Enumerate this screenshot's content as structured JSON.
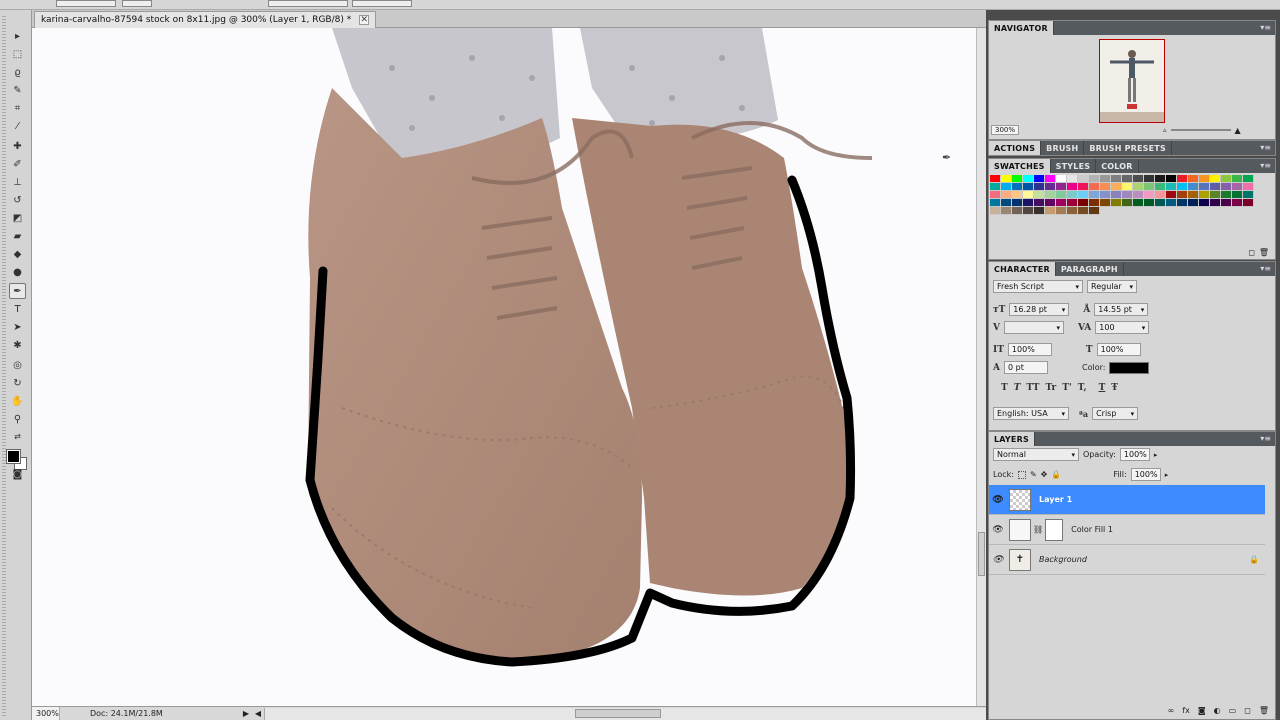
{
  "document": {
    "tab_title": "karina-carvalho-87594 stock on 8x11.jpg @ 300% (Layer 1, RGB/8) *",
    "close_glyph": "✕"
  },
  "status_bar": {
    "zoom": "300%",
    "doc_info": "Doc: 24.1M/21.8M",
    "arrow_right": "▶",
    "arrow_left": "◀"
  },
  "navigator": {
    "title": "NAVIGATOR",
    "zoom": "300%"
  },
  "actions_group": {
    "tabs": [
      "ACTIONS",
      "BRUSH",
      "BRUSH PRESETS"
    ]
  },
  "swatches_group": {
    "tabs": [
      "SWATCHES",
      "STYLES",
      "COLOR"
    ],
    "colors": [
      "#ff0000",
      "#ffff00",
      "#00ff00",
      "#00ffff",
      "#0000ff",
      "#ff00ff",
      "#ffffff",
      "#e6e6e6",
      "#cccccc",
      "#b3b3b3",
      "#999999",
      "#808080",
      "#666666",
      "#4d4d4d",
      "#333333",
      "#1a1a1a",
      "#000000",
      "#ed1c24",
      "#f26522",
      "#f7941d",
      "#fff200",
      "#8dc63f",
      "#39b54a",
      "#00a651",
      "#00a99d",
      "#00aeef",
      "#0072bc",
      "#0054a6",
      "#2e3192",
      "#662d91",
      "#92278f",
      "#ec008c",
      "#ed145b",
      "#f26c4f",
      "#f68e56",
      "#fbaf5d",
      "#fff568",
      "#acd373",
      "#7cc576",
      "#3cb878",
      "#1abbb4",
      "#00bff3",
      "#448ccb",
      "#5674b9",
      "#605ca8",
      "#8560a8",
      "#a864a8",
      "#f06eaa",
      "#f26d7d",
      "#f9ad81",
      "#fdc689",
      "#fff799",
      "#c4df9b",
      "#a3d39c",
      "#82ca9c",
      "#7accc8",
      "#6dcff6",
      "#7ea7d8",
      "#8393ca",
      "#8781bd",
      "#a187be",
      "#bc8dbf",
      "#f49ac2",
      "#f5989d",
      "#9e0b0f",
      "#a0410d",
      "#a36209",
      "#aba000",
      "#598527",
      "#197b30",
      "#007236",
      "#00746b",
      "#0076a3",
      "#004a80",
      "#003471",
      "#1b1464",
      "#440e62",
      "#630460",
      "#9e005d",
      "#9e0039",
      "#790000",
      "#7b2e00",
      "#7d4900",
      "#827b00",
      "#406618",
      "#005e20",
      "#005826",
      "#005952",
      "#005b7f",
      "#003663",
      "#002157",
      "#0d004c",
      "#32004b",
      "#4b0049",
      "#7b0046",
      "#7a0026",
      "#c7b299",
      "#998675",
      "#736357",
      "#534741",
      "#37302d",
      "#c69c6d",
      "#a67c52",
      "#8c6239",
      "#754c24",
      "#603913"
    ]
  },
  "character": {
    "tabs": [
      "CHARACTER",
      "PARAGRAPH"
    ],
    "font_family": "Fresh Script",
    "font_style": "Regular",
    "font_size": "16.28 pt",
    "leading": "14.55 pt",
    "tracking": "100",
    "vertical_scale": "100%",
    "horizontal_scale": "100%",
    "baseline_shift": "0 pt",
    "color_label": "Color:",
    "style_buttons": [
      "T",
      "T",
      "TT",
      "Tr",
      "T'",
      "T,",
      "T",
      "Ŧ"
    ],
    "language": "English: USA",
    "antialias_prefix": "ªa",
    "antialias": "Crisp"
  },
  "layers": {
    "title": "LAYERS",
    "blend_mode": "Normal",
    "opacity_label": "Opacity:",
    "opacity": "100%",
    "lock_label": "Lock:",
    "fill_label": "Fill:",
    "fill": "100%",
    "items": [
      {
        "name": "Layer 1",
        "selected": true
      },
      {
        "name": "Color Fill 1",
        "selected": false
      },
      {
        "name": "Background",
        "selected": false
      }
    ]
  },
  "accent_color": "#3e8bff"
}
